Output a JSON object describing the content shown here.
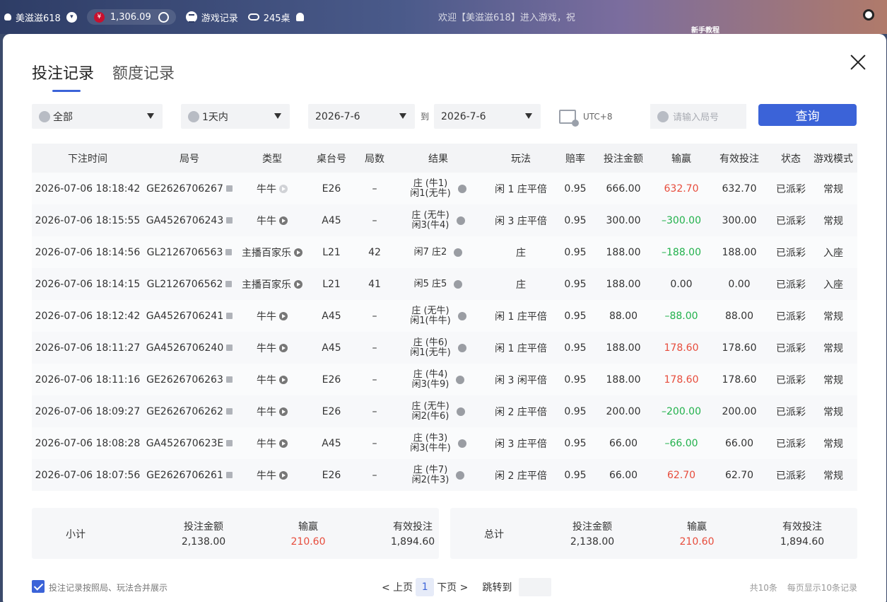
{
  "topbar": {
    "username": "美滋滋618",
    "balance": "1,306.09",
    "game_records": "游戏记录",
    "tables": "245桌",
    "marquee": "欢迎【美滋滋618】进入游戏，祝",
    "tutorial": "新手教程"
  },
  "tabs": [
    "投注记录",
    "额度记录"
  ],
  "filters": {
    "game_type": "全部",
    "time_range": "1天内",
    "date_from": "2026-7-6",
    "to_label": "到",
    "date_to": "2026-7-6",
    "timezone": "UTC+8",
    "round_placeholder": "请输入局号",
    "query_label": "查询"
  },
  "table": {
    "headers": [
      "下注时间",
      "局号",
      "类型",
      "桌台号",
      "局数",
      "结果",
      "玩法",
      "赔率",
      "投注金额",
      "输赢",
      "有效投注",
      "状态",
      "游戏模式"
    ],
    "rows": [
      {
        "time": "2026-07-06 18:18:42",
        "round": "GE2626706267",
        "type": "牛牛",
        "play_dim": true,
        "table": "E26",
        "shoe": "–",
        "result1": "庄 (牛1)",
        "result2": "闲1(无牛)",
        "bet_type": "闲 1 庄平倍",
        "odds": "0.95",
        "amount": "666.00",
        "win": "632.70",
        "win_color": "red",
        "valid": "632.70",
        "status": "已派彩",
        "mode": "常规"
      },
      {
        "time": "2026-07-06 18:15:55",
        "round": "GA4526706243",
        "type": "牛牛",
        "play_dim": false,
        "table": "A45",
        "shoe": "–",
        "result1": "庄 (无牛)",
        "result2": "闲3(牛4)",
        "bet_type": "闲 3 庄平倍",
        "odds": "0.95",
        "amount": "300.00",
        "win": "–300.00",
        "win_color": "green",
        "valid": "300.00",
        "status": "已派彩",
        "mode": "常规"
      },
      {
        "time": "2026-07-06 18:14:56",
        "round": "GL2126706563",
        "type": "主播百家乐",
        "play_dim": false,
        "table": "L21",
        "shoe": "42",
        "result1": "闲7 庄2",
        "result2": "",
        "bet_type": "庄",
        "odds": "0.95",
        "amount": "188.00",
        "win": "–188.00",
        "win_color": "green",
        "valid": "188.00",
        "status": "已派彩",
        "mode": "入座"
      },
      {
        "time": "2026-07-06 18:14:15",
        "round": "GL2126706562",
        "type": "主播百家乐",
        "play_dim": false,
        "table": "L21",
        "shoe": "41",
        "result1": "闲5 庄5",
        "result2": "",
        "bet_type": "庄",
        "odds": "0.95",
        "amount": "188.00",
        "win": "0.00",
        "win_color": "",
        "valid": "0.00",
        "status": "已派彩",
        "mode": "入座"
      },
      {
        "time": "2026-07-06 18:12:42",
        "round": "GA4526706241",
        "type": "牛牛",
        "play_dim": false,
        "table": "A45",
        "shoe": "–",
        "result1": "庄 (无牛)",
        "result2": "闲1(牛牛)",
        "bet_type": "闲 1 庄平倍",
        "odds": "0.95",
        "amount": "88.00",
        "win": "–88.00",
        "win_color": "green",
        "valid": "88.00",
        "status": "已派彩",
        "mode": "常规"
      },
      {
        "time": "2026-07-06 18:11:27",
        "round": "GA4526706240",
        "type": "牛牛",
        "play_dim": false,
        "table": "A45",
        "shoe": "–",
        "result1": "庄 (牛6)",
        "result2": "闲1(无牛)",
        "bet_type": "闲 1 庄平倍",
        "odds": "0.95",
        "amount": "188.00",
        "win": "178.60",
        "win_color": "red",
        "valid": "178.60",
        "status": "已派彩",
        "mode": "常规"
      },
      {
        "time": "2026-07-06 18:11:16",
        "round": "GE2626706263",
        "type": "牛牛",
        "play_dim": false,
        "table": "E26",
        "shoe": "–",
        "result1": "庄 (牛4)",
        "result2": "闲3(牛9)",
        "bet_type": "闲 3 闲平倍",
        "odds": "0.95",
        "amount": "188.00",
        "win": "178.60",
        "win_color": "red",
        "valid": "178.60",
        "status": "已派彩",
        "mode": "常规"
      },
      {
        "time": "2026-07-06 18:09:27",
        "round": "GE2626706262",
        "type": "牛牛",
        "play_dim": false,
        "table": "E26",
        "shoe": "–",
        "result1": "庄 (无牛)",
        "result2": "闲2(牛6)",
        "bet_type": "闲 2 庄平倍",
        "odds": "0.95",
        "amount": "200.00",
        "win": "–200.00",
        "win_color": "green",
        "valid": "200.00",
        "status": "已派彩",
        "mode": "常规"
      },
      {
        "time": "2026-07-06 18:08:28",
        "round": "GA452670623E",
        "type": "牛牛",
        "play_dim": false,
        "table": "A45",
        "shoe": "–",
        "result1": "庄 (牛3)",
        "result2": "闲3(牛牛)",
        "bet_type": "闲 3 庄平倍",
        "odds": "0.95",
        "amount": "66.00",
        "win": "–66.00",
        "win_color": "green",
        "valid": "66.00",
        "status": "已派彩",
        "mode": "常规"
      },
      {
        "time": "2026-07-06 18:07:56",
        "round": "GE2626706261",
        "type": "牛牛",
        "play_dim": false,
        "table": "E26",
        "shoe": "–",
        "result1": "庄 (牛7)",
        "result2": "闲2(牛3)",
        "bet_type": "闲 2 庄平倍",
        "odds": "0.95",
        "amount": "66.00",
        "win": "62.70",
        "win_color": "red",
        "valid": "62.70",
        "status": "已派彩",
        "mode": "常规"
      }
    ]
  },
  "subtotal": {
    "label": "小计",
    "amount_label": "投注金额",
    "amount": "2,138.00",
    "win_label": "输赢",
    "win": "210.60",
    "valid_label": "有效投注",
    "valid": "1,894.60"
  },
  "total": {
    "label": "总计",
    "amount_label": "投注金额",
    "amount": "2,138.00",
    "win_label": "输赢",
    "win": "210.60",
    "valid_label": "有效投注",
    "valid": "1,894.60"
  },
  "footer": {
    "merge_label": "投注记录按照局、玩法合并展示",
    "prev": "< 上页",
    "page": "1",
    "next": "下页 >",
    "jump_label": "跳转到",
    "total_count": "共10条",
    "per_page": "每页显示10条记录"
  },
  "colors": {
    "accent": "#3b63d8",
    "win_positive": "#e74c3c",
    "win_negative": "#22b14c"
  }
}
